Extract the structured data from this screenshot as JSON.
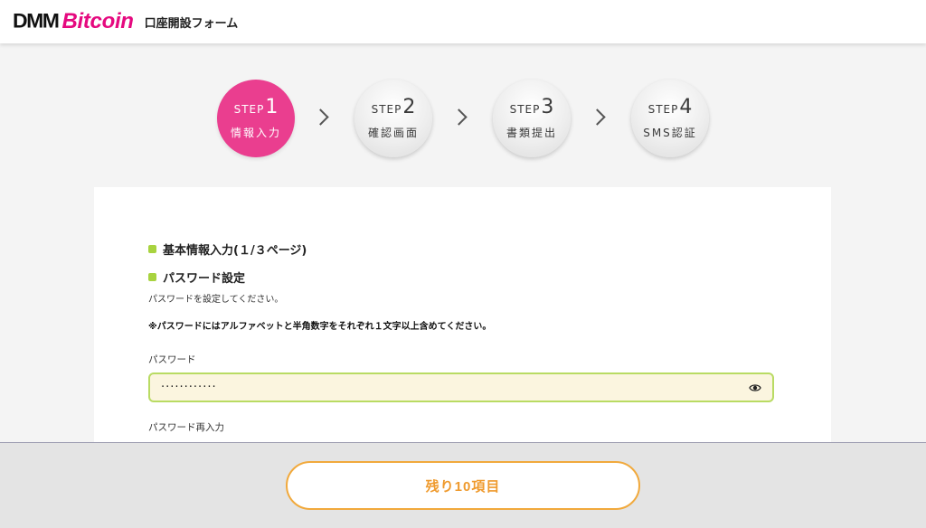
{
  "header": {
    "logo_dmm": "DMM",
    "logo_bitcoin": "Bitcoin",
    "title": "口座開設フォーム",
    "brand_color": "#e5097f"
  },
  "steps": [
    {
      "word": "STEP",
      "number": "1",
      "label": "情報入力",
      "active": true
    },
    {
      "word": "STEP",
      "number": "2",
      "label": "確認画面",
      "active": false
    },
    {
      "word": "STEP",
      "number": "3",
      "label": "書類提出",
      "active": false
    },
    {
      "word": "STEP",
      "number": "4",
      "label": "SMS認証",
      "active": false
    }
  ],
  "form": {
    "section1_heading": "基本情報入力(１/３ページ)",
    "section2_heading": "パスワード設定",
    "description": "パスワードを設定してください。",
    "note": "※パスワードにはアルファベットと半角数字をそれぞれ１文字以上含めてください。",
    "password_label": "パスワード",
    "password_value": "············",
    "password_confirm_label": "パスワード再入力",
    "password_visibility_icon": "eye-icon"
  },
  "footer": {
    "remaining_button": "残り10項目"
  },
  "colors": {
    "active_step": "#ea3e8f",
    "bullet": "#a8d33f",
    "input_bg": "#fbf5df",
    "input_border": "#b9db63",
    "button_accent": "#ef9a2d"
  }
}
